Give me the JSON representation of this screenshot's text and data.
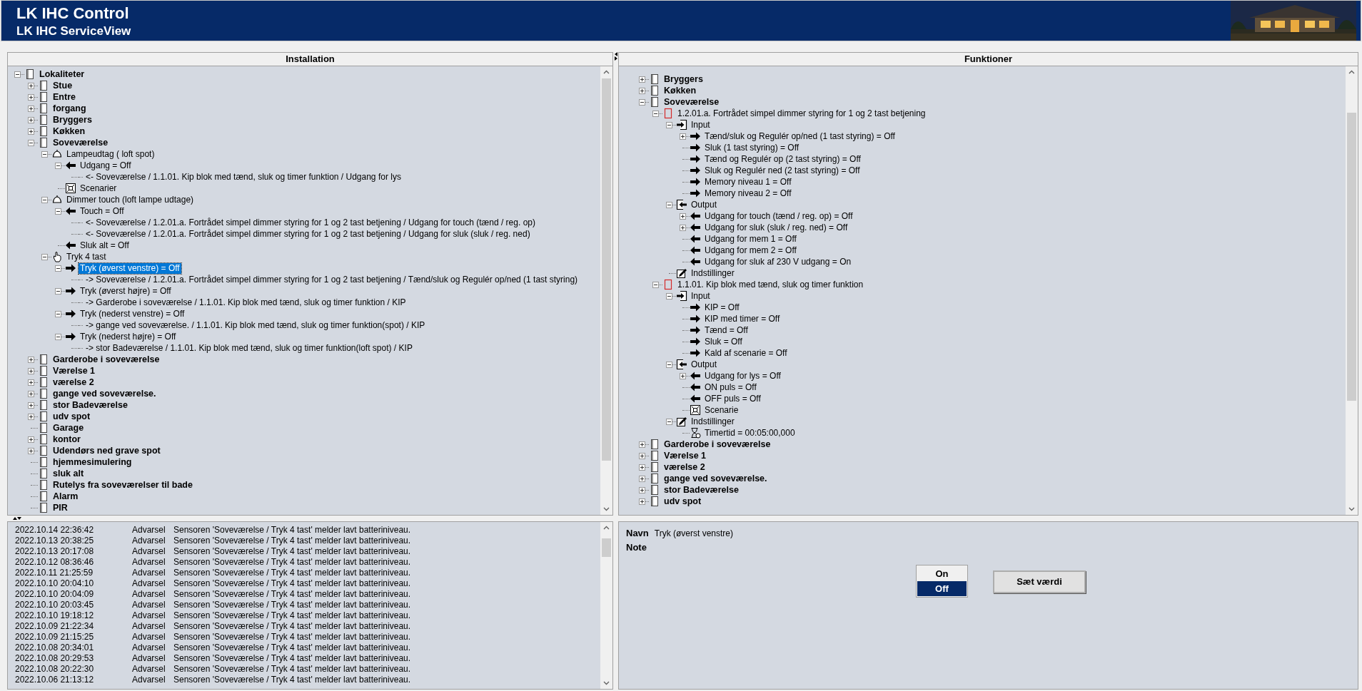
{
  "header": {
    "title": "LK IHC Control",
    "subtitle": "LK IHC ServiceView"
  },
  "installation": {
    "heading": "Installation",
    "nodes": [
      {
        "label": "Lokaliteter",
        "kind": "room",
        "expanded": true,
        "selected": false,
        "children": [
          {
            "label": "Stue",
            "kind": "room",
            "expanded": false,
            "selected": false
          },
          {
            "label": "Entre",
            "kind": "room",
            "expanded": false,
            "selected": false
          },
          {
            "label": "forgang",
            "kind": "room",
            "expanded": false,
            "selected": false
          },
          {
            "label": "Bryggers",
            "kind": "room",
            "expanded": false,
            "selected": false
          },
          {
            "label": "Køkken",
            "kind": "room",
            "expanded": false,
            "selected": false
          },
          {
            "label": "Soveværelse",
            "kind": "room",
            "expanded": true,
            "selected": false,
            "children": [
              {
                "label": "Lampeudtag ( loft spot)",
                "kind": "lamp",
                "expanded": true,
                "selected": false,
                "children": [
                  {
                    "label": "Udgang = Off",
                    "kind": "out",
                    "expanded": true,
                    "selected": false,
                    "children": [
                      {
                        "label": "<- Soveværelse / 1.1.01. Kip blok med tænd, sluk og timer funktion / Udgang for lys",
                        "kind": "link",
                        "selected": false
                      }
                    ]
                  },
                  {
                    "label": "Scenarier",
                    "kind": "scenario",
                    "selected": false
                  }
                ]
              },
              {
                "label": "Dimmer touch (loft lampe udtage)",
                "kind": "lamp",
                "expanded": true,
                "selected": false,
                "children": [
                  {
                    "label": "Touch = Off",
                    "kind": "out",
                    "expanded": true,
                    "selected": false,
                    "children": [
                      {
                        "label": "<- Soveværelse / 1.2.01.a. Fortrådet simpel dimmer styring for 1 og 2 tast betjening / Udgang for touch (tænd / reg. op)",
                        "kind": "link",
                        "selected": false
                      },
                      {
                        "label": "<- Soveværelse / 1.2.01.a. Fortrådet simpel dimmer styring for 1 og 2 tast betjening / Udgang for sluk (sluk / reg. ned)",
                        "kind": "link",
                        "selected": false
                      }
                    ]
                  },
                  {
                    "label": "Sluk alt = Off",
                    "kind": "out",
                    "selected": false
                  }
                ]
              },
              {
                "label": "Tryk 4 tast",
                "kind": "hand",
                "expanded": true,
                "selected": false,
                "children": [
                  {
                    "label": "Tryk (øverst venstre) = Off",
                    "kind": "in",
                    "expanded": true,
                    "selected": true,
                    "children": [
                      {
                        "label": "-> Soveværelse / 1.2.01.a. Fortrådet simpel dimmer styring for 1 og 2 tast betjening / Tænd/sluk og Regulér op/ned (1 tast styring)",
                        "kind": "link",
                        "selected": false
                      }
                    ]
                  },
                  {
                    "label": "Tryk (øverst højre) = Off",
                    "kind": "in",
                    "expanded": true,
                    "selected": false,
                    "children": [
                      {
                        "label": "-> Garderobe i soveværelse / 1.1.01. Kip blok med tænd, sluk og timer funktion / KIP",
                        "kind": "link",
                        "selected": false
                      }
                    ]
                  },
                  {
                    "label": "Tryk (nederst venstre) = Off",
                    "kind": "in",
                    "expanded": true,
                    "selected": false,
                    "children": [
                      {
                        "label": "-> gange ved soveværelse. / 1.1.01. Kip blok med tænd, sluk og timer funktion(spot) / KIP",
                        "kind": "link",
                        "selected": false
                      }
                    ]
                  },
                  {
                    "label": "Tryk (nederst højre) = Off",
                    "kind": "in",
                    "expanded": true,
                    "selected": false,
                    "children": [
                      {
                        "label": "-> stor Badeværelse / 1.1.01. Kip blok med tænd, sluk og timer funktion(loft spot) / KIP",
                        "kind": "link",
                        "selected": false
                      }
                    ]
                  }
                ]
              }
            ]
          },
          {
            "label": "Garderobe i soveværelse",
            "kind": "room",
            "expanded": false,
            "selected": false
          },
          {
            "label": "Værelse 1",
            "kind": "room",
            "expanded": false,
            "selected": false
          },
          {
            "label": "værelse 2",
            "kind": "room",
            "expanded": false,
            "selected": false
          },
          {
            "label": "gange ved soveværelse.",
            "kind": "room",
            "expanded": false,
            "selected": false
          },
          {
            "label": "stor Badeværelse",
            "kind": "room",
            "expanded": false,
            "selected": false
          },
          {
            "label": "udv spot",
            "kind": "room",
            "expanded": false,
            "selected": false
          },
          {
            "label": "Garage",
            "kind": "room",
            "selected": false
          },
          {
            "label": "kontor",
            "kind": "room",
            "expanded": false,
            "selected": false
          },
          {
            "label": "Udendørs ned grave spot",
            "kind": "room",
            "expanded": false,
            "selected": false
          },
          {
            "label": "hjemmesimulering",
            "kind": "room",
            "selected": false
          },
          {
            "label": "sluk alt",
            "kind": "room",
            "selected": false
          },
          {
            "label": "Rutelys fra soveværelser til bade",
            "kind": "room",
            "selected": false
          },
          {
            "label": "Alarm",
            "kind": "room",
            "selected": false
          },
          {
            "label": "PIR",
            "kind": "room",
            "selected": false
          }
        ]
      }
    ]
  },
  "functions": {
    "heading": "Funktioner",
    "nodes": [
      {
        "label": "Bryggers",
        "kind": "room",
        "expanded": false,
        "selected": false
      },
      {
        "label": "Køkken",
        "kind": "room",
        "expanded": false,
        "selected": false
      },
      {
        "label": "Soveværelse",
        "kind": "room",
        "expanded": true,
        "selected": false,
        "children": [
          {
            "label": "1.2.01.a. Fortrådet simpel dimmer styring for 1 og 2 tast betjening",
            "kind": "function",
            "expanded": true,
            "selected": false,
            "children": [
              {
                "label": "Input",
                "kind": "input",
                "expanded": true,
                "selected": false,
                "children": [
                  {
                    "label": "Tænd/sluk og Regulér op/ned (1 tast styring) = Off",
                    "kind": "in",
                    "expanded": false,
                    "selected": false
                  },
                  {
                    "label": "Sluk (1 tast styring) = Off",
                    "kind": "in",
                    "selected": false
                  },
                  {
                    "label": "Tænd og Regulér op (2 tast styring) = Off",
                    "kind": "in",
                    "selected": false
                  },
                  {
                    "label": "Sluk og Regulér ned (2 tast styring) = Off",
                    "kind": "in",
                    "selected": false
                  },
                  {
                    "label": "Memory niveau 1 = Off",
                    "kind": "in",
                    "selected": false
                  },
                  {
                    "label": "Memory niveau 2 = Off",
                    "kind": "in",
                    "selected": false
                  }
                ]
              },
              {
                "label": "Output",
                "kind": "output",
                "expanded": true,
                "selected": false,
                "children": [
                  {
                    "label": "Udgang for touch (tænd / reg. op) = Off",
                    "kind": "out",
                    "expanded": false,
                    "selected": false
                  },
                  {
                    "label": "Udgang for sluk (sluk / reg. ned) = Off",
                    "kind": "out",
                    "expanded": false,
                    "selected": false
                  },
                  {
                    "label": "Udgang for mem 1 = Off",
                    "kind": "out",
                    "selected": false
                  },
                  {
                    "label": "Udgang for mem 2 = Off",
                    "kind": "out",
                    "selected": false
                  },
                  {
                    "label": "Udgang for sluk af 230 V udgang = On",
                    "kind": "out",
                    "selected": false
                  }
                ]
              },
              {
                "label": "Indstillinger",
                "kind": "settings",
                "selected": false
              }
            ]
          },
          {
            "label": "1.1.01. Kip blok med tænd, sluk og timer funktion",
            "kind": "function",
            "expanded": true,
            "selected": false,
            "children": [
              {
                "label": "Input",
                "kind": "input",
                "expanded": true,
                "selected": false,
                "children": [
                  {
                    "label": "KIP = Off",
                    "kind": "in",
                    "selected": false
                  },
                  {
                    "label": "KIP med timer = Off",
                    "kind": "in",
                    "selected": false
                  },
                  {
                    "label": "Tænd = Off",
                    "kind": "in",
                    "selected": false
                  },
                  {
                    "label": "Sluk = Off",
                    "kind": "in",
                    "selected": false
                  },
                  {
                    "label": "Kald af scenarie = Off",
                    "kind": "in",
                    "selected": false
                  }
                ]
              },
              {
                "label": "Output",
                "kind": "output",
                "expanded": true,
                "selected": false,
                "children": [
                  {
                    "label": "Udgang for lys = Off",
                    "kind": "out",
                    "expanded": false,
                    "selected": false
                  },
                  {
                    "label": "ON puls = Off",
                    "kind": "out",
                    "selected": false
                  },
                  {
                    "label": "OFF puls = Off",
                    "kind": "out",
                    "selected": false
                  },
                  {
                    "label": "Scenarie",
                    "kind": "scenario",
                    "selected": false
                  }
                ]
              },
              {
                "label": "Indstillinger",
                "kind": "settings",
                "expanded": true,
                "selected": false,
                "children": [
                  {
                    "label": "Timertid = 00:05:00,000",
                    "kind": "timer",
                    "selected": false
                  }
                ]
              }
            ]
          }
        ]
      },
      {
        "label": "Garderobe i soveværelse",
        "kind": "room",
        "expanded": false,
        "selected": false
      },
      {
        "label": "Værelse 1",
        "kind": "room",
        "expanded": false,
        "selected": false
      },
      {
        "label": "værelse 2",
        "kind": "room",
        "expanded": false,
        "selected": false
      },
      {
        "label": "gange ved soveværelse.",
        "kind": "room",
        "expanded": false,
        "selected": false
      },
      {
        "label": "stor Badeværelse",
        "kind": "room",
        "expanded": false,
        "selected": false
      },
      {
        "label": "udv spot",
        "kind": "room",
        "expanded": false,
        "selected": false
      }
    ]
  },
  "log": [
    {
      "time": "2022.10.14 22:36:42",
      "level": "Advarsel",
      "message": "Sensoren 'Soveværelse / Tryk 4 tast' melder lavt batteriniveau."
    },
    {
      "time": "2022.10.13 20:38:25",
      "level": "Advarsel",
      "message": "Sensoren 'Soveværelse / Tryk 4 tast' melder lavt batteriniveau."
    },
    {
      "time": "2022.10.13 20:17:08",
      "level": "Advarsel",
      "message": "Sensoren 'Soveværelse / Tryk 4 tast' melder lavt batteriniveau."
    },
    {
      "time": "2022.10.12 08:36:46",
      "level": "Advarsel",
      "message": "Sensoren 'Soveværelse / Tryk 4 tast' melder lavt batteriniveau."
    },
    {
      "time": "2022.10.11 21:25:59",
      "level": "Advarsel",
      "message": "Sensoren 'Soveværelse / Tryk 4 tast' melder lavt batteriniveau."
    },
    {
      "time": "2022.10.10 20:04:10",
      "level": "Advarsel",
      "message": "Sensoren 'Soveværelse / Tryk 4 tast' melder lavt batteriniveau."
    },
    {
      "time": "2022.10.10 20:04:09",
      "level": "Advarsel",
      "message": "Sensoren 'Soveværelse / Tryk 4 tast' melder lavt batteriniveau."
    },
    {
      "time": "2022.10.10 20:03:45",
      "level": "Advarsel",
      "message": "Sensoren 'Soveværelse / Tryk 4 tast' melder lavt batteriniveau."
    },
    {
      "time": "2022.10.10 19:18:12",
      "level": "Advarsel",
      "message": "Sensoren 'Soveværelse / Tryk 4 tast' melder lavt batteriniveau."
    },
    {
      "time": "2022.10.09 21:22:34",
      "level": "Advarsel",
      "message": "Sensoren 'Soveværelse / Tryk 4 tast' melder lavt batteriniveau."
    },
    {
      "time": "2022.10.09 21:15:25",
      "level": "Advarsel",
      "message": "Sensoren 'Soveværelse / Tryk 4 tast' melder lavt batteriniveau."
    },
    {
      "time": "2022.10.08 20:34:01",
      "level": "Advarsel",
      "message": "Sensoren 'Soveværelse / Tryk 4 tast' melder lavt batteriniveau."
    },
    {
      "time": "2022.10.08 20:29:53",
      "level": "Advarsel",
      "message": "Sensoren 'Soveværelse / Tryk 4 tast' melder lavt batteriniveau."
    },
    {
      "time": "2022.10.08 20:22:30",
      "level": "Advarsel",
      "message": "Sensoren 'Soveværelse / Tryk 4 tast' melder lavt batteriniveau."
    },
    {
      "time": "2022.10.06 21:13:12",
      "level": "Advarsel",
      "message": "Sensoren 'Soveværelse / Tryk 4 tast' melder lavt batteriniveau."
    }
  ],
  "details": {
    "fields": [
      {
        "label": "Navn",
        "value": "Tryk (øverst venstre)"
      },
      {
        "label": "Note"
      }
    ],
    "options": [
      {
        "label": "On",
        "selected": false
      },
      {
        "label": "Off",
        "selected": true
      }
    ],
    "button": "Sæt værdi"
  }
}
